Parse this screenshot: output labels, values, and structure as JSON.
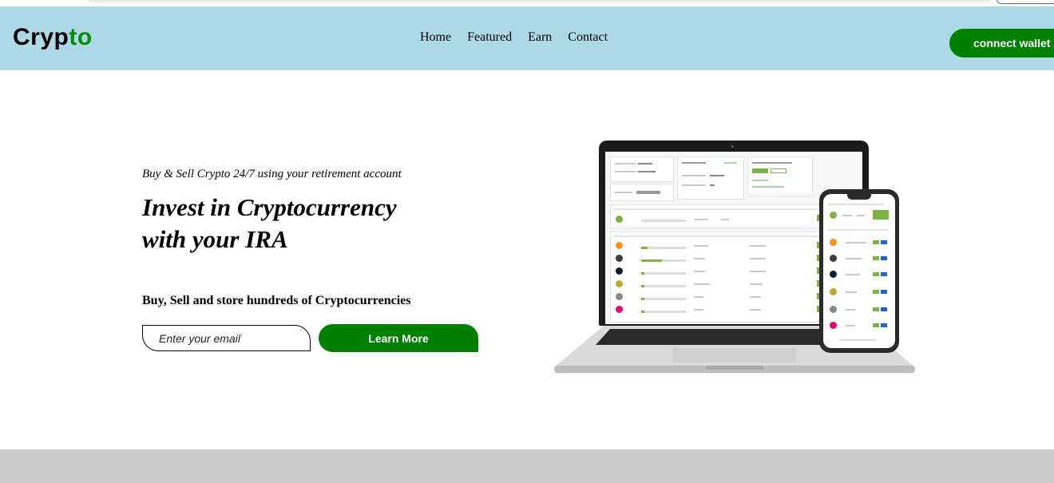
{
  "header": {
    "logo_main": "Cryp",
    "logo_accent": "to",
    "nav": [
      "Home",
      "Featured",
      "Earn",
      "Contact"
    ],
    "connect_label": "connect wallet"
  },
  "hero": {
    "tagline": "Buy & Sell Crypto 24/7 using your retirement account",
    "headline": "Invest in Cryptocurrency with your IRA",
    "subheadline": "Buy, Sell and store hundreds of Cryptocurrencies",
    "email_placeholder": "Enter your email",
    "cta_label": "Learn More"
  },
  "colors": {
    "nav_bg": "#add8e6",
    "brand_green": "#008000",
    "footer_bg": "#cccccc"
  },
  "illustration": {
    "icon": "laptop-and-phone-dashboard-image"
  }
}
